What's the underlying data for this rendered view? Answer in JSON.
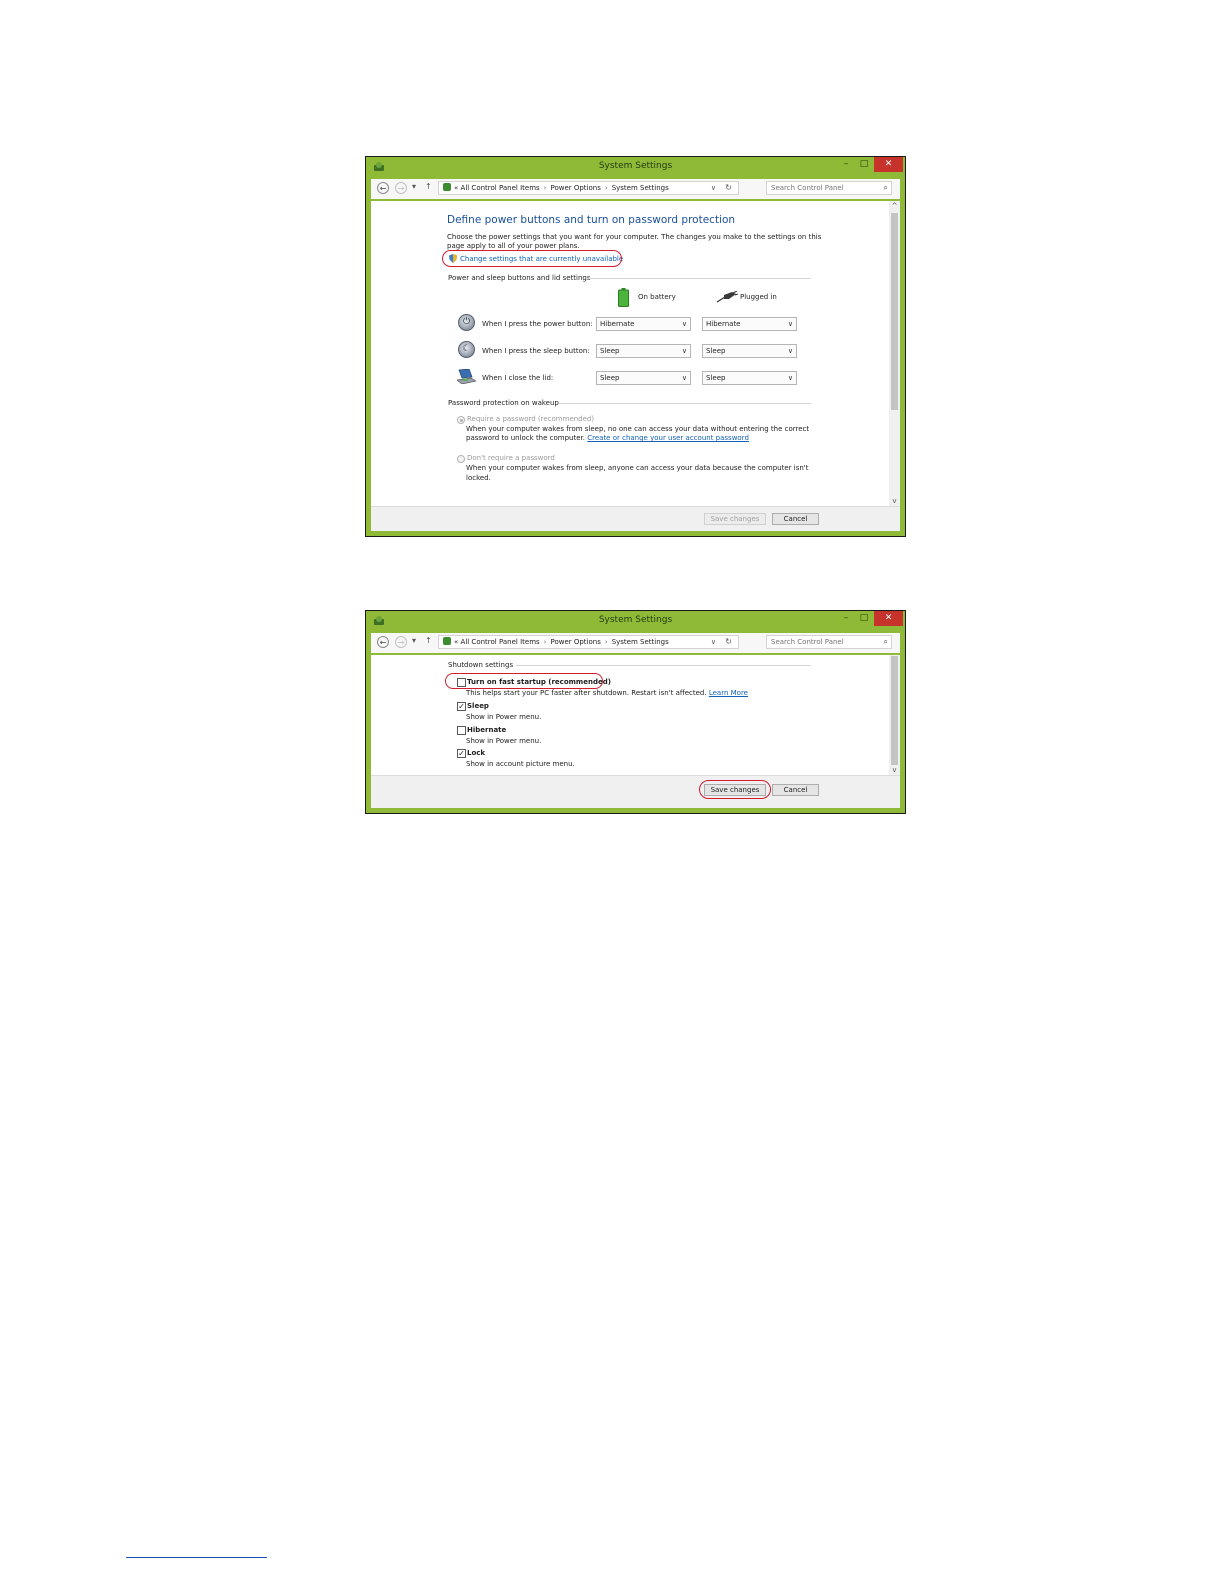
{
  "window": {
    "title": "System Settings",
    "minimize_glyph": "–",
    "maximize_glyph": "□",
    "close_glyph": "✕",
    "colors": {
      "frame": "#8fba38",
      "close": "#c7332b",
      "heading": "#1b4f9a",
      "link": "#1260b8",
      "highlight_oval": "#d11d2f"
    }
  },
  "nav": {
    "back_glyph": "←",
    "forward_glyph": "→",
    "recent_glyph": "▾",
    "up_glyph": "↑",
    "breadcrumb_prefix": "«",
    "breadcrumb": [
      "All Control Panel Items",
      "Power Options",
      "System Settings"
    ],
    "separator": "›",
    "dropdown_glyph": "∨",
    "refresh_glyph": "↻",
    "search_placeholder": "Search Control Panel",
    "search_glyph": "⌕"
  },
  "screen1": {
    "heading": "Define power buttons and turn on password protection",
    "description_line1": "Choose the power settings that you want for your computer. The changes you make to the settings on this",
    "description_line2": "page apply to all of your power plans.",
    "change_settings_link": "Change settings that are currently unavailable",
    "section_power": "Power and sleep buttons and lid settings",
    "col_on_battery": "On battery",
    "col_plugged_in": "Plugged in",
    "rows": [
      {
        "label": "When I press the power button:",
        "battery": "Hibernate",
        "plugged": "Hibernate"
      },
      {
        "label": "When I press the sleep button:",
        "battery": "Sleep",
        "plugged": "Sleep"
      },
      {
        "label": "When I close the lid:",
        "battery": "Sleep",
        "plugged": "Sleep"
      }
    ],
    "chevron": "∨",
    "section_password": "Password protection on wakeup",
    "require_password_label": "Require a password (recommended)",
    "require_desc_line1": "When your computer wakes from sleep, no one can access your data without entering the correct",
    "require_desc_line2_prefix": "password to unlock the computer.",
    "account_password_link": "Create or change your user account password",
    "dont_require_label": "Don't require a password",
    "dont_require_desc_line1": "When your computer wakes from sleep, anyone can access your data because the computer isn't",
    "dont_require_desc_line2": "locked.",
    "save_button": "Save changes",
    "cancel_button": "Cancel",
    "scroll_up": "^",
    "scroll_down": "v"
  },
  "screen2": {
    "section_shutdown": "Shutdown settings",
    "options": [
      {
        "label": "Turn on fast startup (recommended)",
        "desc": "This helps start your PC faster after shutdown. Restart isn't affected.",
        "link": "Learn More",
        "checked": false,
        "check_glyph": ""
      },
      {
        "label": "Sleep",
        "desc": "Show in Power menu.",
        "checked": true,
        "check_glyph": "✓"
      },
      {
        "label": "Hibernate",
        "desc": "Show in Power menu.",
        "checked": false,
        "check_glyph": ""
      },
      {
        "label": "Lock",
        "desc": "Show in account picture menu.",
        "checked": true,
        "check_glyph": "✓"
      }
    ],
    "save_button": "Save changes",
    "cancel_button": "Cancel",
    "scroll_down": "v"
  }
}
